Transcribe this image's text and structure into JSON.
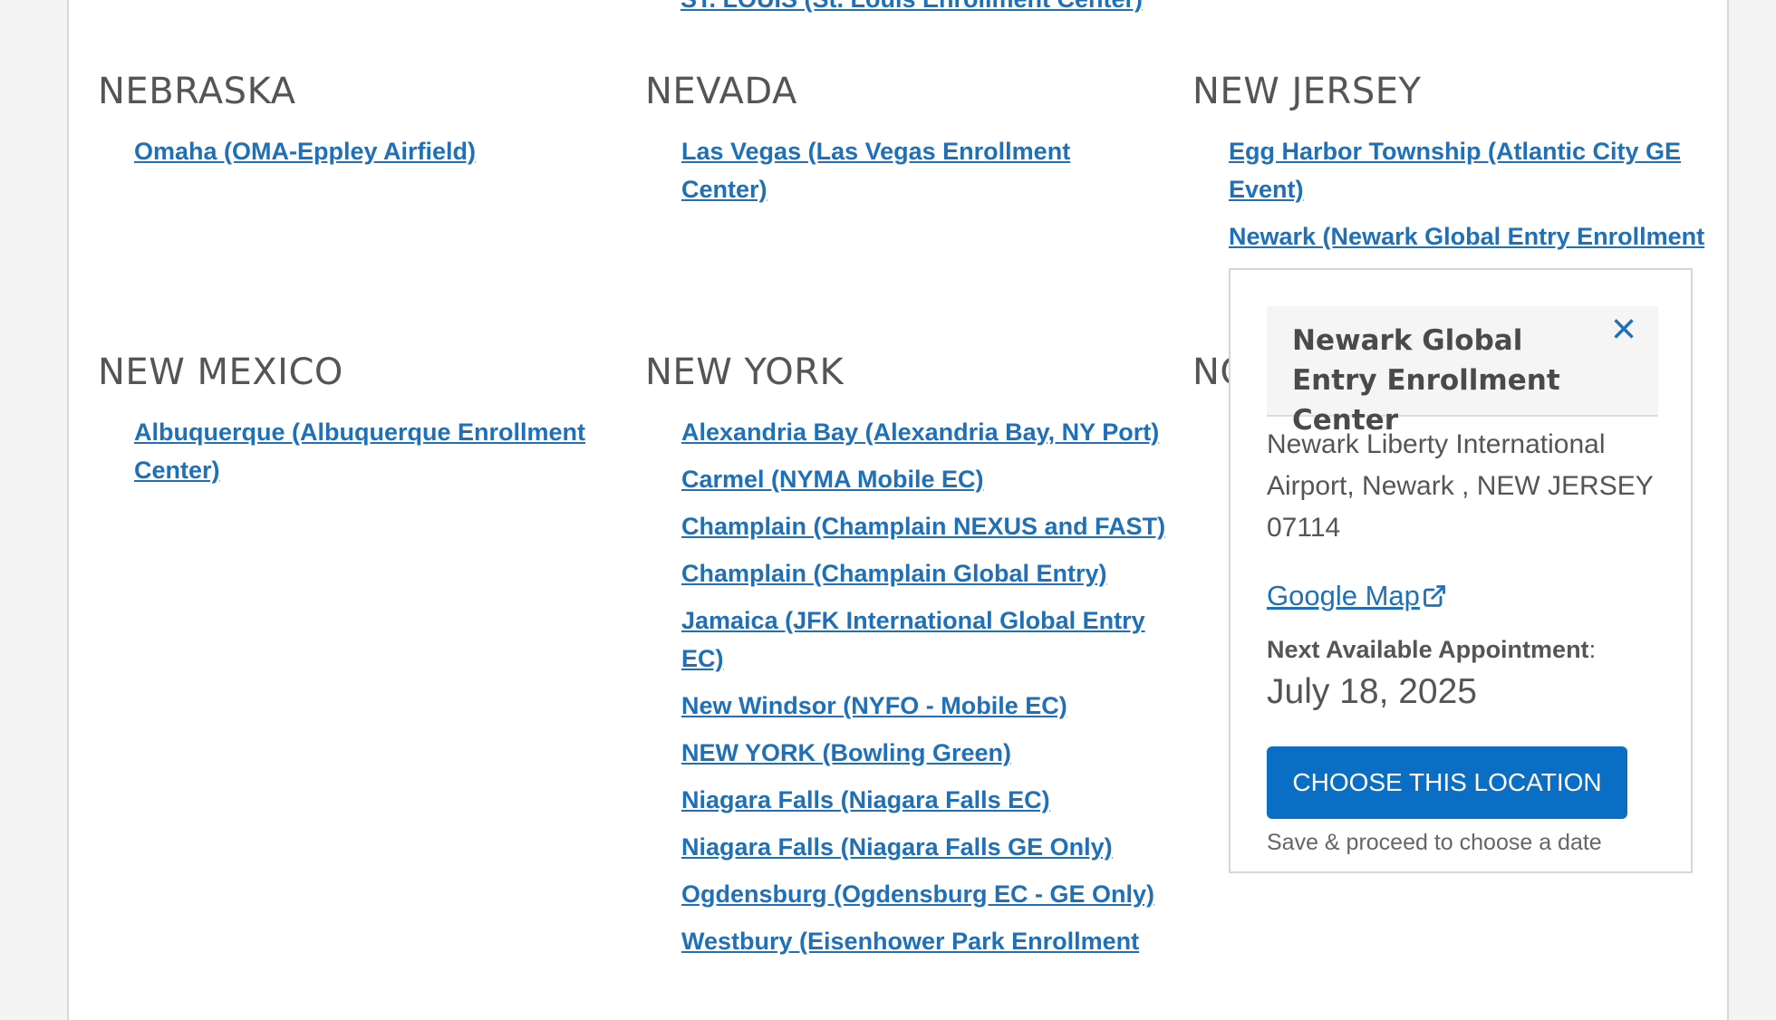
{
  "top_link": "ST. LOUIS (St. Louis Enrollment Center)",
  "states": {
    "nebraska": {
      "name": "NEBRASKA",
      "locations": [
        "Omaha (OMA-Eppley Airfield)"
      ]
    },
    "nevada": {
      "name": "NEVADA",
      "locations": [
        "Las Vegas (Las Vegas Enrollment Center)"
      ]
    },
    "new_jersey": {
      "name": "NEW JERSEY",
      "locations": [
        "Egg Harbor Township (Atlantic City GE Event)",
        "Newark (Newark Global Entry Enrollment"
      ]
    },
    "new_mexico": {
      "name": "NEW MEXICO",
      "locations": [
        "Albuquerque (Albuquerque Enrollment Center)"
      ]
    },
    "new_york": {
      "name": "NEW YORK",
      "locations": [
        "Alexandria Bay (Alexandria Bay, NY Port)",
        "Carmel (NYMA Mobile EC)",
        "Champlain (Champlain NEXUS and FAST)",
        "Champlain (Champlain Global Entry)",
        "Jamaica (JFK International Global Entry EC)",
        "New Windsor (NYFO - Mobile EC)",
        "NEW YORK (Bowling Green)",
        "Niagara Falls (Niagara Falls EC)",
        "Niagara Falls (Niagara Falls GE Only)",
        "Ogdensburg (Ogdensburg EC - GE Only)",
        "Westbury (Eisenhower Park Enrollment"
      ]
    },
    "partial": {
      "name": "NO"
    }
  },
  "popup": {
    "title": "Newark Global Entry Enrollment Center",
    "address": "Newark Liberty International Airport, Newark , NEW JERSEY 07114",
    "map_link": "Google Map",
    "next_label": "Next Available Appointment",
    "next_colon": ":",
    "next_date": "July 18, 2025",
    "button": "CHOOSE THIS LOCATION",
    "note": "Save & proceed to choose a date",
    "close_glyph": "×"
  },
  "colors": {
    "link": "#2070b8",
    "button": "#0a6ec4",
    "heading": "#555555"
  },
  "icons": {
    "close": "close-icon",
    "external": "external-link-icon"
  }
}
